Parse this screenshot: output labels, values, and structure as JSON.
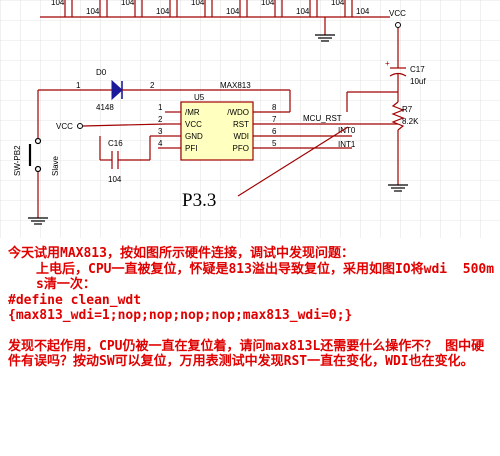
{
  "schematic": {
    "top_caps": [
      "104",
      "104",
      "104",
      "104",
      "104",
      "104",
      "104",
      "104",
      "104",
      "104"
    ],
    "vcc_right": "VCC",
    "vcc_left": "VCC",
    "c17_ref": "C17",
    "c17_val": "10uf",
    "c17_pol": "+",
    "r7_ref": "R7",
    "r7_val": "8.2K",
    "d0_ref": "D0",
    "d0_val": "4148",
    "d0_pin1": "1",
    "d0_pin2": "2",
    "ic_part": "MAX813",
    "ic_ref": "U5",
    "ic_pins_left": [
      {
        "num": "1",
        "name": "/MR"
      },
      {
        "num": "2",
        "name": "VCC"
      },
      {
        "num": "3",
        "name": "GND"
      },
      {
        "num": "4",
        "name": "PFI"
      }
    ],
    "ic_pins_right": [
      {
        "num": "8",
        "name": "/WDO"
      },
      {
        "num": "7",
        "name": "RST"
      },
      {
        "num": "6",
        "name": "WDI"
      },
      {
        "num": "5",
        "name": "PFO"
      }
    ],
    "net_mcu_rst": "MCU_RST",
    "net_int0": "INT0",
    "net_int1": "INT1",
    "c16_ref": "C16",
    "c16_val": "104",
    "sw_ref": "SW-PB2",
    "sw_label": "Slave",
    "annotation": "P3.3"
  },
  "post": {
    "line1": "今天试用MAX813，按如图所示硬件连接，调试中发现问题：",
    "line2": "上电后，CPU一直被复位，怀疑是813溢出导致复位，采用如图IO将wdi  500ms清一次：",
    "line3": "#define clean_wdt",
    "line4": "{max813_wdi=1;nop;nop;nop;nop;max813_wdi=0;}",
    "line5": "发现不起作用，CPU仍被一直在复位着，请问max813L还需要什么操作不？ 图中硬件有误吗？按动SW可以复位，万用表测试中发现RST一直在变化，WDI也在变化。"
  }
}
